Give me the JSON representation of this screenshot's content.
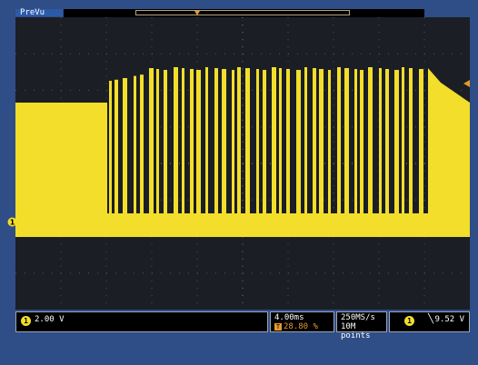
{
  "header": {
    "mode_label": "PreVu"
  },
  "screen": {
    "channel_marker": "1",
    "trace_color": "#f2de2b",
    "trigger_color": "#e59a2b",
    "trigger_position_icon": "T"
  },
  "status_bar": {
    "ch1": {
      "badge": "1",
      "vertical_scale": "2.00 V"
    },
    "timebase": {
      "horizontal_scale": "4.00ms",
      "trigger_position_badge": "T",
      "trigger_position": "28.80 %"
    },
    "acquisition": {
      "sample_rate": "250MS/s",
      "record_length": "10M points"
    },
    "trigger": {
      "source_badge": "1",
      "slope_icon": "falling-edge-icon",
      "slope_glyph": "╲",
      "level": "9.52 V"
    }
  }
}
